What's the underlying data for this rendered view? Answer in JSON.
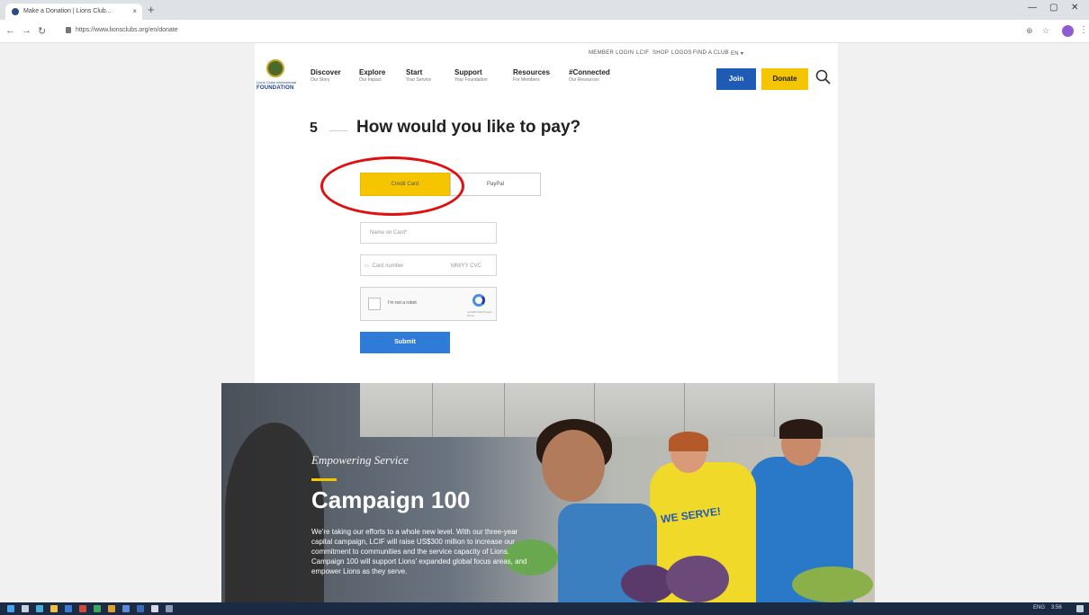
{
  "browser": {
    "tab_title": "Make a Donation | Lions Club...",
    "tab_close": "×",
    "new_tab": "+",
    "url": "https://www.lionsclubs.org/en/donate",
    "win_min": "—",
    "win_max": "▢",
    "win_close": "✕"
  },
  "header": {
    "utility": [
      "MEMBER LOGIN",
      "LCIF",
      "SHOP",
      "LOGOS",
      "FIND A CLUB",
      "EN ▾"
    ],
    "logo_small": "Lions Clubs International",
    "logo_text": "FOUNDATION",
    "nav": [
      {
        "title": "Discover",
        "sub": "Our Story"
      },
      {
        "title": "Explore",
        "sub": "Our Impact"
      },
      {
        "title": "Start",
        "sub": "Your Service"
      },
      {
        "title": "Support",
        "sub": "Your Foundation"
      },
      {
        "title": "Resources",
        "sub": "For Members"
      },
      {
        "title": "#Connected",
        "sub": "Our Resources"
      }
    ],
    "join": "Join",
    "donate": "Donate"
  },
  "step": {
    "number": "5",
    "title": "How would you like to pay?"
  },
  "payment": {
    "credit_card": "Credit Card",
    "paypal": "PayPal",
    "name_placeholder": "Name on Card*",
    "card_placeholder": "Card number",
    "expiry_cvc": "MM/YY  CVC",
    "captcha_label": "I'm not a robot",
    "captcha_sub": "reCAPTCHA Privacy - Terms",
    "submit": "Submit"
  },
  "hero": {
    "eyebrow": "Empowering Service",
    "title": "Campaign 100",
    "body": "We're taking our efforts to a whole new level. With our three-year capital campaign, LCIF will raise US$300 million to increase our commitment to communities and the service capacity of Lions. Campaign 100 will support Lions' expanded global focus areas, and empower Lions as they serve.",
    "shirt_text": "WE SERVE!"
  },
  "tray": {
    "time": "3:56",
    "lang": "ENG"
  },
  "colors": {
    "brand_blue": "#1f5bb5",
    "brand_yellow": "#f5c500",
    "annotation_red": "#e01010"
  }
}
